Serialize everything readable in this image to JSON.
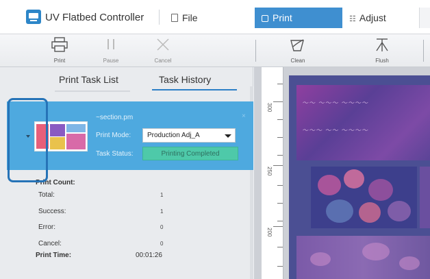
{
  "app": {
    "title": "UV Flatbed Controller",
    "menu": {
      "file": "File",
      "print": "Print",
      "adjust": "Adjust"
    }
  },
  "toolbar": {
    "print": "Print",
    "pause": "Pause",
    "cancel": "Cancel",
    "clean": "Clean",
    "flush": "Flush"
  },
  "tabs": {
    "print_task_list": "Print Task List",
    "task_history": "Task History"
  },
  "task": {
    "name": "~section.pm",
    "close": "×",
    "mode_label": "Print Mode:",
    "mode_value": "Production Adj_A",
    "status_label": "Task Status:",
    "status_value": "Printing Completed"
  },
  "stats": {
    "count_title": "Print Count:",
    "rows": [
      {
        "label": "Total:",
        "value": "1"
      },
      {
        "label": "Success:",
        "value": "1"
      },
      {
        "label": "Error:",
        "value": "0"
      },
      {
        "label": "Cancel:",
        "value": "0"
      }
    ],
    "time_label": "Print Time:",
    "time_value": "00:01:26"
  },
  "ruler": {
    "labels": [
      "300",
      "250",
      "200"
    ]
  },
  "colors": {
    "accent": "#3f8fd0",
    "task_card": "#4ea9df",
    "status_completed": "#4ec9a9",
    "highlight": "#2673b7"
  }
}
